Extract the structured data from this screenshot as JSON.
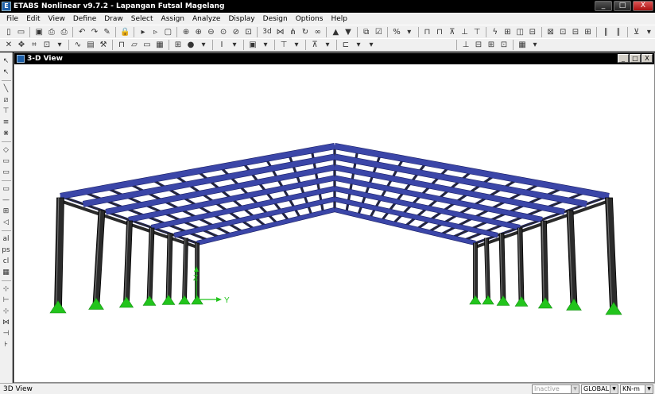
{
  "window": {
    "title": "ETABS Nonlinear v9.7.2 - Lapangan Futsal Magelang",
    "controls": [
      "_",
      "□",
      "X"
    ]
  },
  "menu": [
    "File",
    "Edit",
    "View",
    "Define",
    "Draw",
    "Select",
    "Assign",
    "Analyze",
    "Display",
    "Design",
    "Options",
    "Help"
  ],
  "toolbar1": {
    "view_3d_label": "3d",
    "icons": [
      "new-icon",
      "open-icon",
      "save-icon",
      "print-icon",
      "print-preview-icon",
      "undo-icon",
      "redo-icon",
      "pencil-icon",
      "lock-icon",
      "run-icon",
      "zoom-in-icon",
      "zoom-out-icon",
      "pan-icon",
      "restore-icon",
      "refresh-icon",
      "view-3d-icon",
      "plan-icon",
      "elevation-icon",
      "rotate-icon",
      "perspective-icon",
      "up-arrow-icon",
      "down-arrow-icon",
      "object-shrink-icon",
      "set-display-icon",
      "assign-icon"
    ]
  },
  "toolbar2": {
    "icons": [
      "pointer-icon",
      "move-icon",
      "reshape-icon",
      "graph-icon",
      "chart-icon",
      "tools-icon",
      "frame-icon",
      "shell-icon",
      "grid-icon",
      "text-icon",
      "color-icon",
      "filter-icon",
      "sections-icon",
      "display-icon"
    ]
  },
  "left_toolbar": {
    "icons": [
      "select-pointer-icon",
      "reshape-icon",
      "draw-line-icon",
      "draw-brace-icon",
      "draw-column-icon",
      "draw-beam-icon",
      "draw-area-icon",
      "draw-wall-icon",
      "draw-opening-icon",
      "draw-floor-icon",
      "draw-rect-icon",
      "draw-link-icon",
      "draw-grid-icon",
      "all-select-icon",
      "ps-icon",
      "clr-icon",
      "restore-icon",
      "snap-point-icon",
      "snap-end-icon",
      "snap-mid-icon",
      "snap-intersect-icon",
      "snap-perp-icon"
    ]
  },
  "child_window": {
    "title": "3-D View",
    "axis": {
      "z_label": "Z",
      "y_label": "Y"
    }
  },
  "status": {
    "left": "3D View",
    "mode": "Inactive",
    "coord_system": "GLOBAL",
    "units": "KN-m"
  },
  "colors": {
    "beam": "#3b46a8",
    "beam_edge": "#1a1f66",
    "column": "#2b2b2b",
    "support": "#22c41c",
    "axis": "#22c41c"
  }
}
